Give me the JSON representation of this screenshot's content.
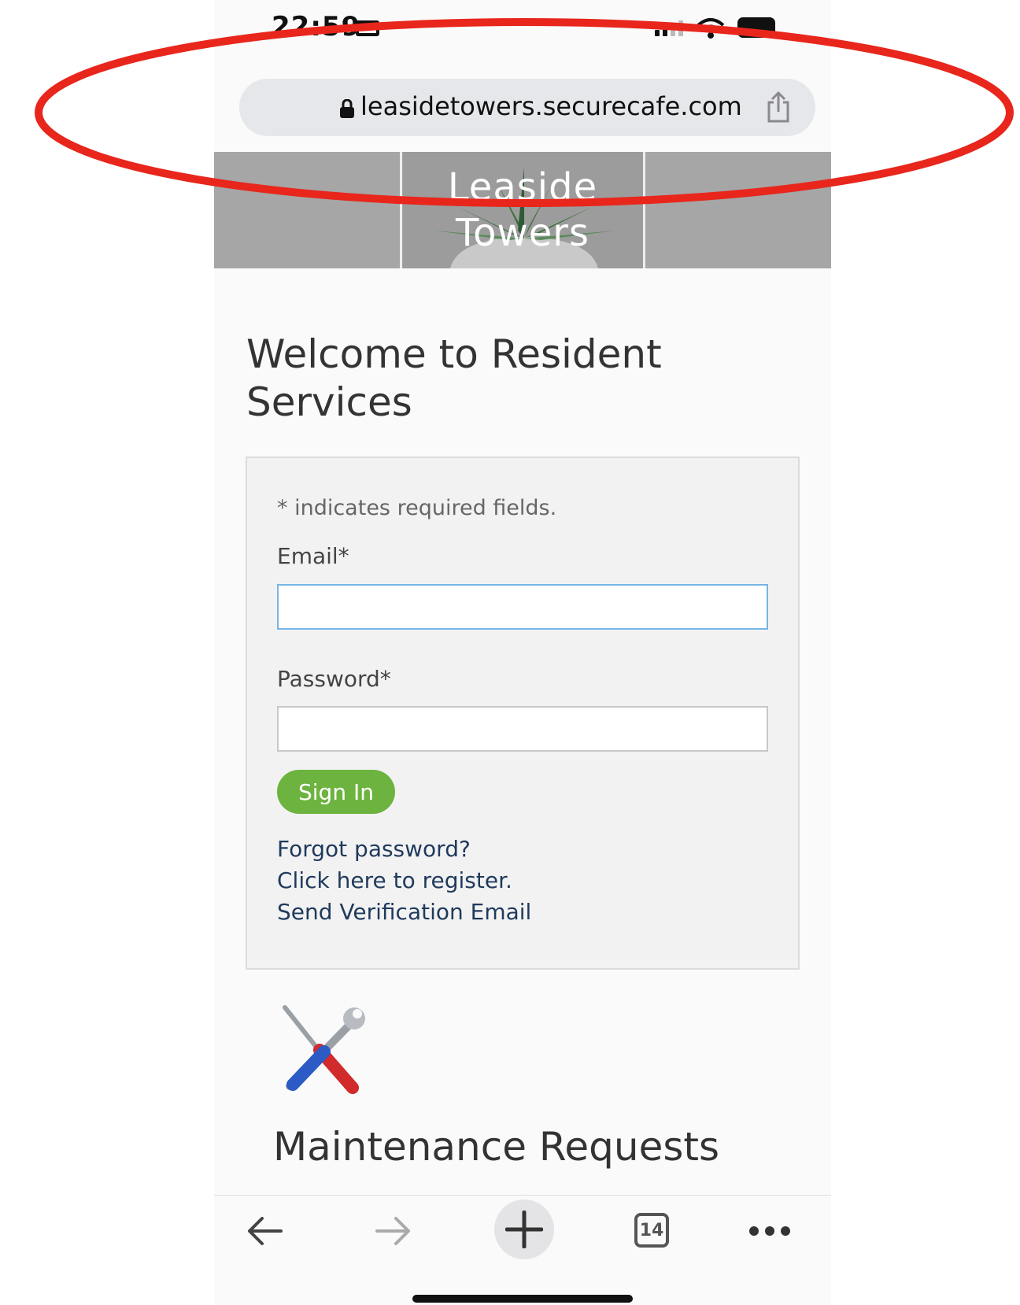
{
  "status_bar": {
    "time": "22:59"
  },
  "browser": {
    "url": "leasidetowers.securecafe.com",
    "tab_count": "14"
  },
  "banner": {
    "title_line1": "Leaside",
    "title_line2": "Towers"
  },
  "welcome_heading": "Welcome to Resident Services",
  "login": {
    "required_note": "* indicates required fields.",
    "email_label": "Email*",
    "email_value": "",
    "password_label": "Password*",
    "password_value": "",
    "signin_label": "Sign In",
    "forgot_password": "Forgot password?",
    "register": "Click here to register.",
    "send_verification": "Send Verification Email"
  },
  "maintenance": {
    "title": "Maintenance Requests"
  },
  "colors": {
    "annotation_red": "#e8261c",
    "signin_green": "#6db33f",
    "link_blue": "#1f3a5c",
    "input_focus_blue": "#75b5e5"
  },
  "icons": [
    "message-icon",
    "signal-icon",
    "wifi-icon",
    "battery-icon",
    "lock-icon",
    "share-icon",
    "tools-icon",
    "back-icon",
    "forward-icon",
    "new-tab-icon",
    "tabs-icon",
    "more-icon"
  ]
}
